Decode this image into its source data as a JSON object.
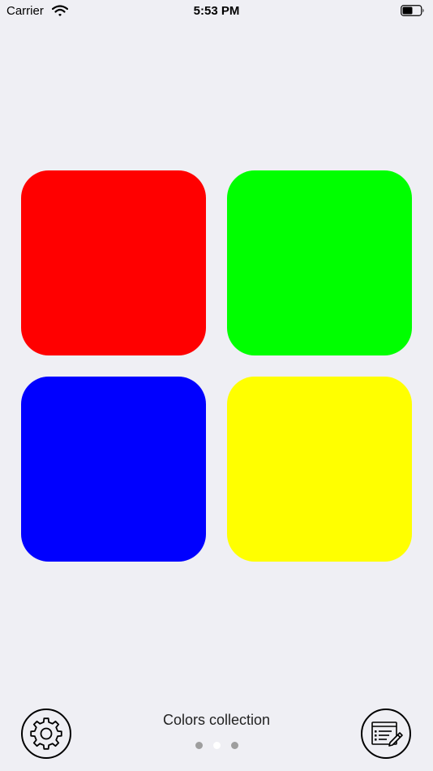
{
  "status_bar": {
    "carrier": "Carrier",
    "time": "5:53 PM",
    "wifi_icon": "wifi-icon",
    "battery_icon": "battery-icon"
  },
  "tiles": [
    {
      "name": "red",
      "color": "#ff0000"
    },
    {
      "name": "green",
      "color": "#00ff00"
    },
    {
      "name": "blue",
      "color": "#0000ff"
    },
    {
      "name": "yellow",
      "color": "#ffff00"
    }
  ],
  "footer": {
    "title": "Colors collection",
    "settings_icon": "gear-icon",
    "notes_icon": "document-edit-icon",
    "page_count": 3,
    "current_page": 2
  },
  "colors": {
    "background": "#efeff4",
    "dot_inactive": "#9e9e9e",
    "dot_active": "#ffffff"
  }
}
